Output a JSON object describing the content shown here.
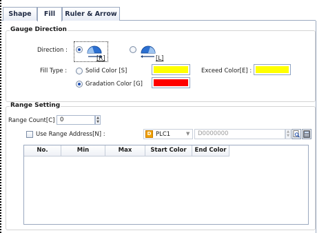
{
  "tabs": [
    "Shape",
    "Fill",
    "Ruler & Arrow"
  ],
  "gauge": {
    "title": "Gauge Direction",
    "direction_label": "Direction :",
    "dir_right_key": "[R]",
    "dir_left_key": "[L]",
    "fill_type_label": "Fill Type :",
    "solid_color_label": "Solid Color [S]",
    "gradation_color_label": "Gradation Color [G]",
    "exceed_color_label": "Exceed Color[E] :",
    "selected_direction": "R",
    "selected_fill": "Gradation Color",
    "solid_color": "#ffff00",
    "exceed_color": "#ffff00",
    "gradation_color": "#ff0000"
  },
  "range": {
    "title": "Range Setting",
    "count_label": "Range Count[C] :",
    "count_value": "0",
    "use_address_label": "Use Range Address[N] :",
    "plc_icon": "D",
    "plc_value": "PLC1",
    "address_value": "D0000000",
    "columns": [
      "No.",
      "Min",
      "Max",
      "Start Color",
      "End Color"
    ]
  },
  "icons": {
    "gauge_right": "gauge-right-icon",
    "gauge_left": "gauge-left-icon",
    "device_search": "device-search-icon",
    "keypad": "keypad-icon"
  }
}
